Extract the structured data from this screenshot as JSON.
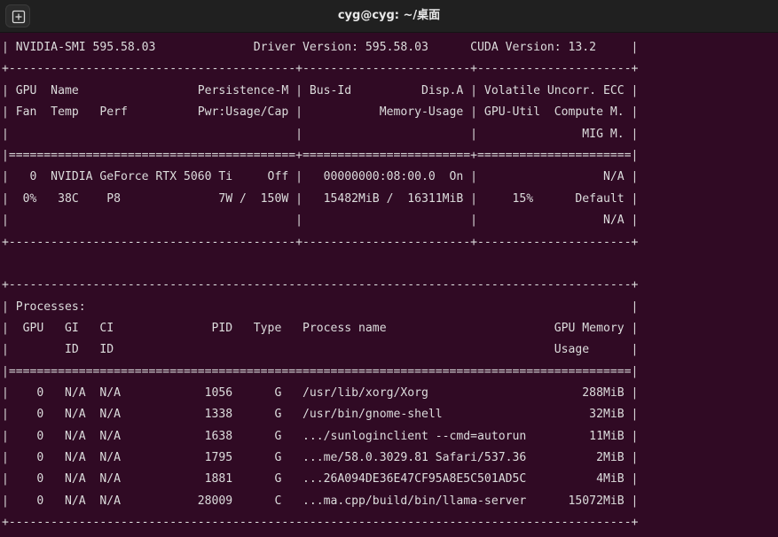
{
  "window": {
    "title": "cyg@cyg: ~/桌面"
  },
  "terminal": {
    "lines": [
      "| NVIDIA-SMI 595.58.03              Driver Version: 595.58.03      CUDA Version: 13.2     |",
      "+-----------------------------------------+------------------------+----------------------+",
      "| GPU  Name                 Persistence-M | Bus-Id          Disp.A | Volatile Uncorr. ECC |",
      "| Fan  Temp   Perf          Pwr:Usage/Cap |           Memory-Usage | GPU-Util  Compute M. |",
      "|                                         |                        |               MIG M. |",
      "|=========================================+========================+======================|",
      "|   0  NVIDIA GeForce RTX 5060 Ti     Off |   00000000:08:00.0  On |                  N/A |",
      "|  0%   38C    P8              7W /  150W |   15482MiB /  16311MiB |     15%      Default |",
      "|                                         |                        |                  N/A |",
      "+-----------------------------------------+------------------------+----------------------+",
      "",
      "+-----------------------------------------------------------------------------------------+",
      "| Processes:                                                                              |",
      "|  GPU   GI   CI              PID   Type   Process name                        GPU Memory |",
      "|        ID   ID                                                               Usage      |",
      "|=========================================================================================|",
      "|    0   N/A  N/A            1056      G   /usr/lib/xorg/Xorg                      288MiB |",
      "|    0   N/A  N/A            1338      G   /usr/bin/gnome-shell                     32MiB |",
      "|    0   N/A  N/A            1638      G   .../sunloginclient --cmd=autorun         11MiB |",
      "|    0   N/A  N/A            1795      G   ...me/58.0.3029.81 Safari/537.36          2MiB |",
      "|    0   N/A  N/A            1881      G   ...26A094DE36E47CF95A8E5C501AD5C          4MiB |",
      "|    0   N/A  N/A           28009      C   ...ma.cpp/build/bin/llama-server      15072MiB |",
      "+-----------------------------------------------------------------------------------------+"
    ]
  }
}
